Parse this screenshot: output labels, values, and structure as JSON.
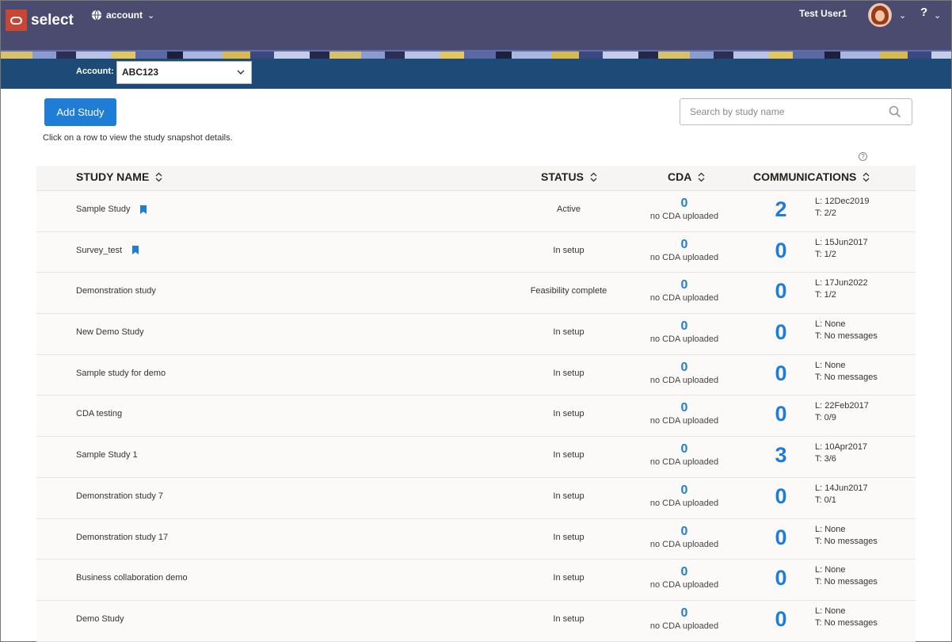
{
  "header": {
    "logo_text": "select",
    "account_menu": "account",
    "user_name": "Test User1",
    "help": "?"
  },
  "account_bar": {
    "label": "Account:",
    "selected": "ABC123"
  },
  "actions": {
    "add_study": "Add Study",
    "search_placeholder": "Search by study name",
    "hint": "Click on a row to view the study snapshot details."
  },
  "table": {
    "columns": {
      "name": "STUDY NAME",
      "status": "STATUS",
      "cda": "CDA",
      "communications": "COMMUNICATIONS"
    },
    "rows": [
      {
        "name": "Sample Study",
        "bookmarked": true,
        "status": "Active",
        "cda_count": "0",
        "cda_text": "no CDA uploaded",
        "comm_count": "2",
        "comm_last": "L: 12Dec2019",
        "comm_total": "T: 2/2"
      },
      {
        "name": "Survey_test",
        "bookmarked": true,
        "status": "In setup",
        "cda_count": "0",
        "cda_text": "no CDA uploaded",
        "comm_count": "0",
        "comm_last": "L: 15Jun2017",
        "comm_total": "T: 1/2"
      },
      {
        "name": "Demonstration study",
        "bookmarked": false,
        "status": "Feasibility complete",
        "cda_count": "0",
        "cda_text": "no CDA uploaded",
        "comm_count": "0",
        "comm_last": "L: 17Jun2022",
        "comm_total": "T: 1/2"
      },
      {
        "name": "New Demo Study",
        "bookmarked": false,
        "status": "In setup",
        "cda_count": "0",
        "cda_text": "no CDA uploaded",
        "comm_count": "0",
        "comm_last": "L: None",
        "comm_total": "T: No messages"
      },
      {
        "name": "Sample study for demo",
        "bookmarked": false,
        "status": "In setup",
        "cda_count": "0",
        "cda_text": "no CDA uploaded",
        "comm_count": "0",
        "comm_last": "L: None",
        "comm_total": "T: No messages"
      },
      {
        "name": "CDA testing",
        "bookmarked": false,
        "status": "In setup",
        "cda_count": "0",
        "cda_text": "no CDA uploaded",
        "comm_count": "0",
        "comm_last": "L: 22Feb2017",
        "comm_total": "T: 0/9"
      },
      {
        "name": "Sample Study 1",
        "bookmarked": false,
        "status": "In setup",
        "cda_count": "0",
        "cda_text": "no CDA uploaded",
        "comm_count": "3",
        "comm_last": "L: 10Apr2017",
        "comm_total": "T: 3/6"
      },
      {
        "name": "Demonstration study 7",
        "bookmarked": false,
        "status": "In setup",
        "cda_count": "0",
        "cda_text": "no CDA uploaded",
        "comm_count": "0",
        "comm_last": "L: 14Jun2017",
        "comm_total": "T: 0/1"
      },
      {
        "name": "Demonstration study 17",
        "bookmarked": false,
        "status": "In setup",
        "cda_count": "0",
        "cda_text": "no CDA uploaded",
        "comm_count": "0",
        "comm_last": "L: None",
        "comm_total": "T: No messages"
      },
      {
        "name": "Business collaboration demo",
        "bookmarked": false,
        "status": "In setup",
        "cda_count": "0",
        "cda_text": "no CDA uploaded",
        "comm_count": "0",
        "comm_last": "L: None",
        "comm_total": "T: No messages"
      },
      {
        "name": "Demo Study",
        "bookmarked": false,
        "status": "In setup",
        "cda_count": "0",
        "cda_text": "no CDA uploaded",
        "comm_count": "0",
        "comm_last": "L: None",
        "comm_total": "T: No messages"
      }
    ]
  },
  "colors": {
    "header_bg": "#4a4b6f",
    "account_bar_bg": "#1e4a78",
    "accent": "#1f7dd6",
    "logo_red": "#c74634"
  },
  "icons": [
    "globe-icon",
    "chevron-down-icon",
    "avatar",
    "help-icon",
    "search-icon",
    "info-icon",
    "sort-icon",
    "bookmark-icon"
  ]
}
